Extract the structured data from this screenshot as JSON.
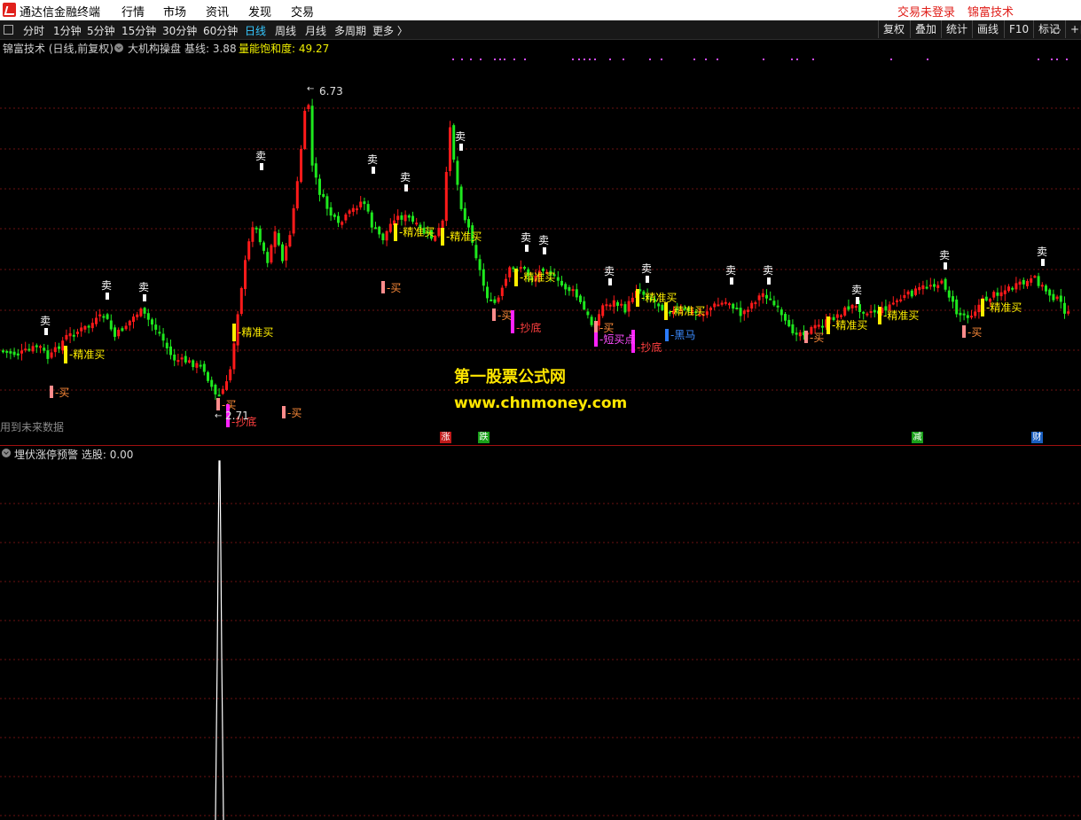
{
  "menubar": {
    "title": "通达信金融终端",
    "items": [
      "行情",
      "市场",
      "资讯",
      "发现",
      "交易"
    ],
    "login_status": "交易未登录",
    "brand": "锦富技术"
  },
  "toolbar": {
    "periods": [
      "分时",
      "1分钟",
      "5分钟",
      "15分钟",
      "30分钟",
      "60分钟",
      "日线",
      "周线",
      "月线",
      "多周期",
      "更多 〉"
    ],
    "active_period": "日线",
    "right_buttons": [
      "复权",
      "叠加",
      "统计",
      "画线",
      "F10",
      "标记",
      "+自"
    ]
  },
  "infobar": {
    "stock": "锦富技术 (日线,前复权)",
    "indicator": "大机构操盘",
    "baseline": "基线: 3.88",
    "saturation": "量能饱和度: 49.27"
  },
  "price_labels": {
    "high": "6.73",
    "low": "2.71"
  },
  "future_data_note": "用到未来数据",
  "watermark": {
    "line1": "第一股票公式网",
    "line2": "www.chnmoney.com"
  },
  "event_markers": [
    {
      "label": "涨",
      "color": "#c01a1a"
    },
    {
      "label": "跌",
      "color": "#1aa01a"
    },
    {
      "label": "减",
      "color": "#1aa01a"
    },
    {
      "label": "财",
      "color": "#1a5fc0"
    }
  ],
  "signals": {
    "sell": "卖",
    "buy": "买",
    "precise_buy": "精准买",
    "bottom": "抄底",
    "short_buy": "短买点",
    "dark_horse": "黑马"
  },
  "indicator_panel": {
    "title": "埋伏涨停预警",
    "selection": "选股: 0.00"
  },
  "colors": {
    "up": "#ff1a1a",
    "down": "#1ee81e",
    "grid": "#6b1212",
    "sell_mark": "#ffffff",
    "buy_mark": "#ff8c8c",
    "precise_buy_mark": "#ffee00",
    "bottom_mark": "#ff22ff",
    "dark_horse_mark": "#2a7bff"
  }
}
